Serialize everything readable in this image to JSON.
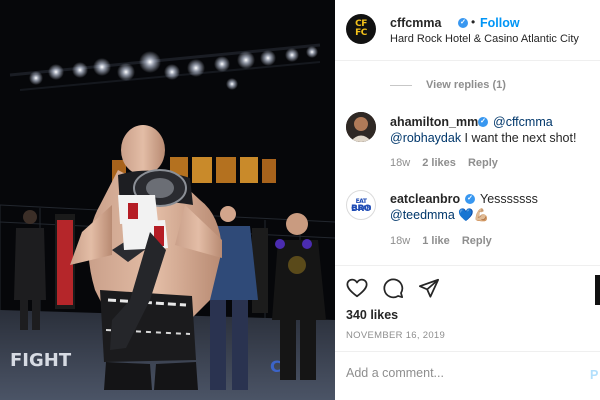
{
  "post": {
    "author": "cffcmma",
    "author_logo_text": [
      "CF",
      "FC"
    ],
    "dot": "•",
    "follow_label": "Follow",
    "location": "Hard Rock Hotel & Casino Atlantic City",
    "photo_banner_text": [
      "FIGHT",
      "CF"
    ],
    "likes": "340 likes",
    "date": "NOVEMBER 16, 2019"
  },
  "thread": {
    "view_replies": "View replies (1)"
  },
  "comments": [
    {
      "user": "ahamilton_mma",
      "verified": true,
      "mention_inline": "@cffcmma",
      "mention_line2": "@robhaydak",
      "text": " I want the next shot!",
      "age": "18w",
      "likes": "2 likes",
      "reply": "Reply"
    },
    {
      "user": "eatcleanbro",
      "verified": true,
      "avatar_logo": [
        "EAT CLEAN",
        "BRO"
      ],
      "inline_text": "Yesssssss",
      "mention_line2": "@teedmma",
      "emoji": "💙💪🏼",
      "age": "18w",
      "likes": "1 like",
      "reply": "Reply"
    }
  ],
  "composer": {
    "placeholder": "Add a comment...",
    "post_label": "P"
  },
  "icons": {
    "like": "heart-icon",
    "comment": "comment-icon",
    "share": "share-icon",
    "verified": "verified-badge-icon"
  },
  "colors": {
    "accent": "#0095f6",
    "verified": "#3897f0",
    "muted": "#8e8e8e",
    "mention": "#00376b"
  }
}
